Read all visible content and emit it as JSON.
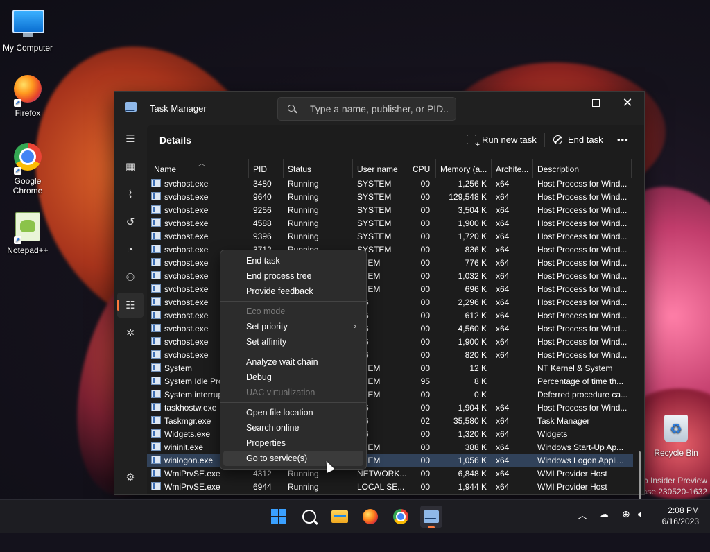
{
  "desktop": {
    "icons": [
      {
        "label": "My Computer"
      },
      {
        "label": "Firefox"
      },
      {
        "label": "Google\nChrome"
      },
      {
        "label": "Notepad++"
      },
      {
        "label": "Recycle Bin"
      }
    ],
    "watermark_line1": "ro Insider Preview",
    "watermark_line2": "ease.230520-1632"
  },
  "window": {
    "title": "Task Manager",
    "search_placeholder": "Type a name, publisher, or PID...",
    "section_title": "Details",
    "run_new_task": "Run new task",
    "end_task": "End task",
    "more": "•••"
  },
  "columns": [
    "Name",
    "PID",
    "Status",
    "User name",
    "CPU",
    "Memory (a...",
    "Archite...",
    "Description"
  ],
  "rows": [
    {
      "name": "svchost.exe",
      "pid": "3480",
      "status": "Running",
      "user": "SYSTEM",
      "cpu": "00",
      "mem": "1,256 K",
      "arch": "x64",
      "desc": "Host Process for Wind..."
    },
    {
      "name": "svchost.exe",
      "pid": "9640",
      "status": "Running",
      "user": "SYSTEM",
      "cpu": "00",
      "mem": "129,548 K",
      "arch": "x64",
      "desc": "Host Process for Wind..."
    },
    {
      "name": "svchost.exe",
      "pid": "9256",
      "status": "Running",
      "user": "SYSTEM",
      "cpu": "00",
      "mem": "3,504 K",
      "arch": "x64",
      "desc": "Host Process for Wind..."
    },
    {
      "name": "svchost.exe",
      "pid": "4588",
      "status": "Running",
      "user": "SYSTEM",
      "cpu": "00",
      "mem": "1,900 K",
      "arch": "x64",
      "desc": "Host Process for Wind..."
    },
    {
      "name": "svchost.exe",
      "pid": "9396",
      "status": "Running",
      "user": "SYSTEM",
      "cpu": "00",
      "mem": "1,720 K",
      "arch": "x64",
      "desc": "Host Process for Wind..."
    },
    {
      "name": "svchost.exe",
      "pid": "3712",
      "status": "Running",
      "user": "SYSTEM",
      "cpu": "00",
      "mem": "836 K",
      "arch": "x64",
      "desc": "Host Process for Wind..."
    },
    {
      "name": "svchost.exe",
      "pid": "",
      "status": "",
      "user": "STEM",
      "cpu": "00",
      "mem": "776 K",
      "arch": "x64",
      "desc": "Host Process for Wind..."
    },
    {
      "name": "svchost.exe",
      "pid": "",
      "status": "",
      "user": "STEM",
      "cpu": "00",
      "mem": "1,032 K",
      "arch": "x64",
      "desc": "Host Process for Wind..."
    },
    {
      "name": "svchost.exe",
      "pid": "",
      "status": "",
      "user": "STEM",
      "cpu": "00",
      "mem": "696 K",
      "arch": "x64",
      "desc": "Host Process for Wind..."
    },
    {
      "name": "svchost.exe",
      "pid": "",
      "status": "",
      "user": "M6",
      "cpu": "00",
      "mem": "2,296 K",
      "arch": "x64",
      "desc": "Host Process for Wind..."
    },
    {
      "name": "svchost.exe",
      "pid": "",
      "status": "",
      "user": "M6",
      "cpu": "00",
      "mem": "612 K",
      "arch": "x64",
      "desc": "Host Process for Wind..."
    },
    {
      "name": "svchost.exe",
      "pid": "",
      "status": "",
      "user": "M6",
      "cpu": "00",
      "mem": "4,560 K",
      "arch": "x64",
      "desc": "Host Process for Wind..."
    },
    {
      "name": "svchost.exe",
      "pid": "",
      "status": "",
      "user": "M6",
      "cpu": "00",
      "mem": "1,900 K",
      "arch": "x64",
      "desc": "Host Process for Wind..."
    },
    {
      "name": "svchost.exe",
      "pid": "",
      "status": "",
      "user": "M6",
      "cpu": "00",
      "mem": "820 K",
      "arch": "x64",
      "desc": "Host Process for Wind..."
    },
    {
      "name": "System",
      "pid": "",
      "status": "",
      "user": "STEM",
      "cpu": "00",
      "mem": "12 K",
      "arch": "",
      "desc": "NT Kernel & System"
    },
    {
      "name": "System Idle Pro",
      "pid": "",
      "status": "",
      "user": "STEM",
      "cpu": "95",
      "mem": "8 K",
      "arch": "",
      "desc": "Percentage of time th..."
    },
    {
      "name": "System interrup",
      "pid": "",
      "status": "",
      "user": "STEM",
      "cpu": "00",
      "mem": "0 K",
      "arch": "",
      "desc": "Deferred procedure ca..."
    },
    {
      "name": "taskhostw.exe",
      "pid": "",
      "status": "",
      "user": "M6",
      "cpu": "00",
      "mem": "1,904 K",
      "arch": "x64",
      "desc": "Host Process for Wind..."
    },
    {
      "name": "Taskmgr.exe",
      "pid": "",
      "status": "",
      "user": "M6",
      "cpu": "02",
      "mem": "35,580 K",
      "arch": "x64",
      "desc": "Task Manager"
    },
    {
      "name": "Widgets.exe",
      "pid": "",
      "status": "",
      "user": "M6",
      "cpu": "00",
      "mem": "1,320 K",
      "arch": "x64",
      "desc": "Widgets"
    },
    {
      "name": "wininit.exe",
      "pid": "",
      "status": "",
      "user": "STEM",
      "cpu": "00",
      "mem": "388 K",
      "arch": "x64",
      "desc": "Windows Start-Up Ap..."
    },
    {
      "name": "winlogon.exe",
      "pid": "",
      "status": "",
      "user": "STEM",
      "cpu": "00",
      "mem": "1,056 K",
      "arch": "x64",
      "desc": "Windows Logon Appli...",
      "selected": true
    },
    {
      "name": "WmiPrvSE.exe",
      "pid": "4312",
      "status": "Running",
      "user": "NETWORK...",
      "cpu": "00",
      "mem": "6,848 K",
      "arch": "x64",
      "desc": "WMI Provider Host"
    },
    {
      "name": "WmiPrvSE.exe",
      "pid": "6944",
      "status": "Running",
      "user": "LOCAL SE...",
      "cpu": "00",
      "mem": "1,944 K",
      "arch": "x64",
      "desc": "WMI Provider Host"
    }
  ],
  "context_menu": [
    {
      "label": "End task"
    },
    {
      "label": "End process tree"
    },
    {
      "label": "Provide feedback"
    },
    {
      "sep": true
    },
    {
      "label": "Eco mode",
      "disabled": true
    },
    {
      "label": "Set priority",
      "submenu": true
    },
    {
      "label": "Set affinity"
    },
    {
      "sep": true
    },
    {
      "label": "Analyze wait chain"
    },
    {
      "label": "Debug"
    },
    {
      "label": "UAC virtualization",
      "disabled": true
    },
    {
      "sep": true
    },
    {
      "label": "Open file location"
    },
    {
      "label": "Search online"
    },
    {
      "label": "Properties"
    },
    {
      "label": "Go to service(s)",
      "hover": true
    }
  ],
  "taskbar": {
    "time": "2:08 PM",
    "date": "6/16/2023"
  }
}
